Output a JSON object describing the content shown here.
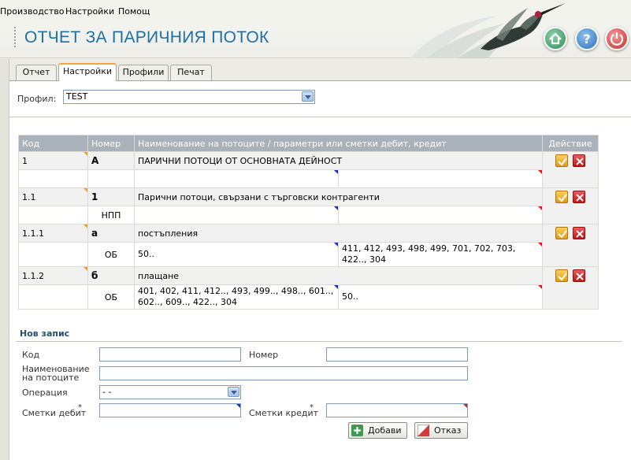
{
  "menu": [
    "Производство",
    "Настройки",
    "Помощ"
  ],
  "header": {
    "title": "ОТЧЕТ ЗА ПАРИЧНИЯ ПОТОК"
  },
  "tabs": [
    {
      "label": "Отчет",
      "active": false
    },
    {
      "label": "Настройки",
      "active": true
    },
    {
      "label": "Профили",
      "active": false
    },
    {
      "label": "Печат",
      "active": false
    }
  ],
  "profile": {
    "label": "Профил:",
    "value": "TEST"
  },
  "table": {
    "headers": {
      "code": "Код",
      "number": "Номер",
      "name": "Наименование на потоците / параметри или сметки дебит, кредит",
      "action": "Действие"
    },
    "rows": [
      {
        "code": "1",
        "number": "А",
        "name": "ПАРИЧНИ ПОТОЦИ ОТ ОСНОВНАТА ДЕЙНОСТ",
        "sub_op": "",
        "debit": "",
        "credit": ""
      },
      {
        "code": "1.1",
        "number": "1",
        "name": "Парични потоци, свързани с търговски контрагенти",
        "sub_op": "НПП",
        "debit": "",
        "credit": ""
      },
      {
        "code": "1.1.1",
        "number": "а",
        "name": "постъпления",
        "sub_op": "ОБ",
        "debit": "50..",
        "credit": "411, 412, 493, 498, 499, 701, 702, 703, 422.., 304"
      },
      {
        "code": "1.1.2",
        "number": "б",
        "name": "плащане",
        "sub_op": "ОБ",
        "debit": "401, 402, 411, 412.., 493, 499.., 498.., 601.., 602.., 609.., 422.., 304",
        "credit": "50.."
      }
    ]
  },
  "new_record": {
    "title": "Нов запис",
    "code_label": "Код",
    "number_label": "Номер",
    "name_label": "Наименование на потоците",
    "operation_label": "Операция",
    "operation_value": "- -",
    "debit_label": "Сметки дебит",
    "credit_label": "Сметки кредит",
    "required_mark": "*",
    "add_button": "Добави",
    "cancel_button": "Отказ"
  },
  "colors": {
    "title": "#1f6fa0",
    "tab_accent": "#f2a640",
    "table_header": "#a9b2ba"
  }
}
